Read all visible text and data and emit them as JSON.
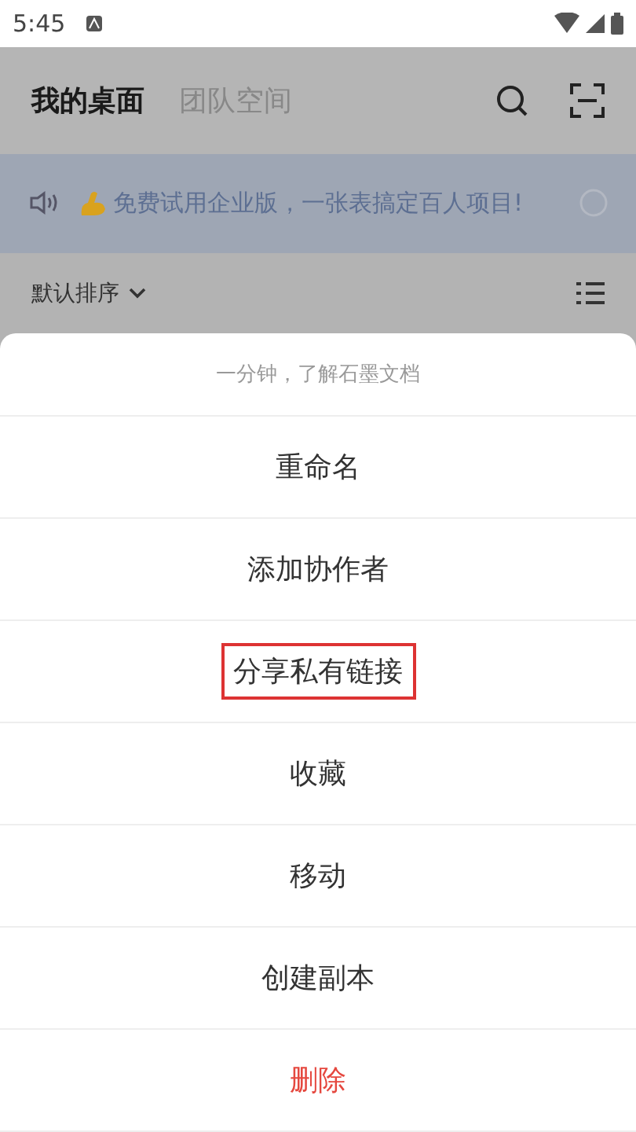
{
  "status_bar": {
    "time": "5:45"
  },
  "header": {
    "tabs": [
      {
        "label": "我的桌面",
        "selected": true
      },
      {
        "label": "团队空间",
        "selected": false
      }
    ]
  },
  "banner": {
    "text": "免费试用企业版，一张表搞定百人项目!"
  },
  "sort": {
    "label": "默认排序"
  },
  "sheet": {
    "title": "一分钟，了解石墨文档",
    "items": [
      {
        "label": "重命名",
        "kind": "normal",
        "highlighted": false
      },
      {
        "label": "添加协作者",
        "kind": "normal",
        "highlighted": false
      },
      {
        "label": "分享私有链接",
        "kind": "normal",
        "highlighted": true
      },
      {
        "label": "收藏",
        "kind": "normal",
        "highlighted": false
      },
      {
        "label": "移动",
        "kind": "normal",
        "highlighted": false
      },
      {
        "label": "创建副本",
        "kind": "normal",
        "highlighted": false
      },
      {
        "label": "删除",
        "kind": "danger",
        "highlighted": false
      }
    ]
  }
}
